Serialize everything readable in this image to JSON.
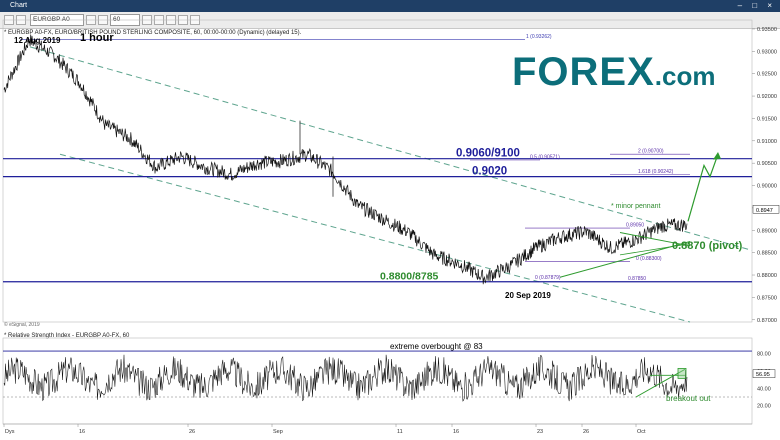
{
  "window": {
    "title": "Chart",
    "controls": "– □ ×"
  },
  "toolbar": {
    "symbol": "EURGBP A0",
    "period": "60"
  },
  "header": {
    "main": "* EURGBP A0-FX, EURO/BRITISH POUND STERLING COMPOSITE, 60, 00:00-00:00 (Dynamic) (delayed 15).",
    "rsi": "* Relative Strength Index - EURGBP A0-FX, 60",
    "credit": "© eSignal, 2019"
  },
  "logo": {
    "main": "FOREX",
    "suffix": ".com",
    "color": "#0c6e7a"
  },
  "chart_data": [
    {
      "type": "line",
      "title": "1 hour",
      "ylim": [
        0.8695,
        0.937
      ],
      "y_ticks": [
        0.87,
        0.875,
        0.88,
        0.885,
        0.89,
        0.895,
        0.9,
        0.905,
        0.91,
        0.915,
        0.92,
        0.925,
        0.93,
        0.935
      ],
      "y_tick_labels": [
        "0.87000",
        "0.87500",
        "0.88000",
        "0.88500",
        "0.89000",
        "0.89500",
        "0.90000",
        "0.90500",
        "0.91000",
        "0.91500",
        "0.92000",
        "0.92500",
        "0.93000",
        "0.93500"
      ],
      "x_tick_labels": [
        "Dys",
        "16",
        "26",
        "Sep",
        "11",
        "16",
        "23",
        "26",
        "Oct"
      ],
      "last_price": "0.8947",
      "path": [
        [
          0.92,
          0.923
        ],
        [
          0.9326,
          0.9326
        ],
        [
          0.9285,
          0.9295
        ],
        [
          0.924,
          0.922
        ],
        [
          0.915,
          0.912
        ],
        [
          0.91,
          0.911
        ],
        [
          0.905,
          0.903
        ],
        [
          0.906,
          0.907
        ],
        [
          0.907,
          0.901
        ],
        [
          0.904,
          0.901
        ],
        [
          0.904,
          0.906
        ],
        [
          0.904,
          0.907
        ],
        [
          0.91,
          0.904
        ],
        [
          0.906,
          0.9
        ],
        [
          0.896,
          0.895
        ],
        [
          0.893,
          0.892
        ],
        [
          0.891,
          0.888
        ],
        [
          0.885,
          0.884
        ],
        [
          0.882,
          0.883
        ],
        [
          0.88,
          0.8787
        ],
        [
          0.881,
          0.883
        ],
        [
          0.887,
          0.885
        ],
        [
          0.889,
          0.888
        ],
        [
          0.889,
          0.8905
        ],
        [
          0.885,
          0.887
        ],
        [
          0.887,
          0.889
        ],
        [
          0.892,
          0.89
        ],
        [
          0.891,
          0.8915
        ]
      ],
      "levels": [
        {
          "label": "1 (0.93262)",
          "value": 0.93262,
          "color": "#3a3ab0"
        },
        {
          "label": "2 (0.90700)",
          "value": 0.907,
          "color": "#5a2ea8"
        },
        {
          "label": "0.5 (0.90571)",
          "value": 0.90571,
          "color": "#5a2ea8"
        },
        {
          "label": "1.618 (0.90242)",
          "value": 0.90242,
          "color": "#5a2ea8"
        },
        {
          "label": "0.89050",
          "value": 0.8905,
          "color": "#5a2ea8"
        },
        {
          "label": "0 (0.88300)",
          "value": 0.883,
          "color": "#5a2ea8"
        },
        {
          "label": "0 (0.87879)",
          "value": 0.87879,
          "color": "#5a2ea8"
        },
        {
          "label": "0.87850",
          "value": 0.8785,
          "color": "#5a2ea8"
        }
      ],
      "annotations": [
        {
          "text": "12 Aug 2019",
          "color": "#000000"
        },
        {
          "text": "20 Sep 2019",
          "color": "#000000"
        },
        {
          "text": "0.9060/9100",
          "color": "#1f1f9a"
        },
        {
          "text": "0.9020",
          "color": "#1f1f9a"
        },
        {
          "text": "0.8800/8785",
          "color": "#2e8b2e"
        },
        {
          "text": "* minor pennant",
          "color": "#2e8b2e"
        },
        {
          "text": "0.8870 (pivot)",
          "color": "#2e8b2e"
        }
      ]
    },
    {
      "type": "line",
      "title": "Relative Strength Index",
      "ylim": [
        15,
        90
      ],
      "y_ticks": [
        20,
        40,
        60,
        80
      ],
      "y_tick_labels": [
        "20.00",
        "40.00",
        "60.00",
        "80.00"
      ],
      "last_value": "56.95",
      "overbought": 83,
      "oversold": 30,
      "annotations": [
        {
          "text": "extreme overbought @ 83",
          "color": "#000000"
        },
        {
          "text": "breakout out",
          "color": "#2e8b2e"
        }
      ]
    }
  ]
}
